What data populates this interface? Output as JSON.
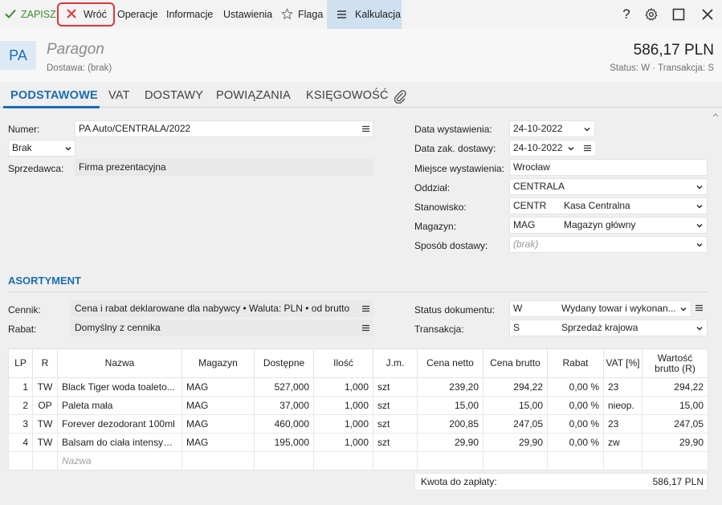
{
  "toolbar": {
    "save_label": "ZAPISZ",
    "back_label": "Wróć",
    "operations_label": "Operacje",
    "info_label": "Informacje",
    "settings_label": "Ustawienia",
    "flag_label": "Flaga",
    "calc_label": "Kalkulacja",
    "right_icons": [
      "help-icon",
      "gear-icon",
      "maximize-icon",
      "close-icon"
    ],
    "help_glyph": "?"
  },
  "header": {
    "badge": "PA",
    "title": "Paragon",
    "subtitle": "Dostawa: (brak)",
    "amount": "586,17 PLN",
    "status_line": "Status: W  ·  Transakcja: S"
  },
  "tabs": [
    "PODSTAWOWE",
    "VAT",
    "DOSTAWY",
    "POWIĄZANIA",
    "KSIĘGOWOŚĆ"
  ],
  "form": {
    "numer_label": "Numer:",
    "numer_value": "PA Auto/CENTRALA/2022",
    "brak_value": "Brak",
    "sprzedawca_label": "Sprzedawca:",
    "sprzedawca_value": "Firma prezentacyjna",
    "data_wyst_label": "Data wystawienia:",
    "data_wyst_value": "24-10-2022",
    "data_zak_label": "Data zak. dostawy:",
    "data_zak_value": "24-10-2022",
    "miejsce_label": "Miejsce wystawienia:",
    "miejsce_value": "Wrocław",
    "oddzial_label": "Oddział:",
    "oddzial_value": "CENTRALA",
    "stanowisko_label": "Stanowisko:",
    "stanowisko_code": "CENTR",
    "stanowisko_name": "Kasa Centralna",
    "magazyn_label": "Magazyn:",
    "magazyn_code": "MAG",
    "magazyn_name": "Magazyn główny",
    "sposob_label": "Sposób dostawy:",
    "sposob_placeholder": "(brak)"
  },
  "assortment": {
    "title": "ASORTYMENT",
    "cennik_label": "Cennik:",
    "cennik_value": "Cena i rabat deklarowane dla nabywcy • Waluta: PLN • od brutto",
    "rabat_label": "Rabat:",
    "rabat_value": "Domyślny z cennika",
    "status_label": "Status dokumentu:",
    "status_code": "W",
    "status_name": "Wydany towar i wykonan...",
    "transakcja_label": "Transakcja:",
    "transakcja_code": "S",
    "transakcja_name": "Sprzedaż krajowa"
  },
  "table": {
    "columns": [
      "LP",
      "R",
      "Nazwa",
      "Magazyn",
      "Dostępne",
      "Ilość",
      "J.m.",
      "Cena netto",
      "Cena brutto",
      "Rabat",
      "VAT [%]",
      "Wartość brutto (R)"
    ],
    "rows": [
      [
        "1",
        "TW",
        "Black Tiger woda toaleto...",
        "MAG",
        "527,000",
        "1,000",
        "szt",
        "239,20",
        "294,22",
        "0,00 %",
        "23",
        "294,22"
      ],
      [
        "2",
        "OP",
        "Paleta mała",
        "MAG",
        "37,000",
        "1,000",
        "szt",
        "15,00",
        "15,00",
        "0,00 %",
        "nieop.",
        "15,00"
      ],
      [
        "3",
        "TW",
        "Forever dezodorant 100ml",
        "MAG",
        "460,000",
        "1,000",
        "szt",
        "200,85",
        "247,05",
        "0,00 %",
        "23",
        "247,05"
      ],
      [
        "4",
        "TW",
        "Balsam do ciała intensyw...",
        "MAG",
        "195,000",
        "1,000",
        "szt",
        "29,90",
        "29,90",
        "0,00 %",
        "zw",
        "29,90"
      ]
    ],
    "new_row_placeholder": "Nazwa"
  },
  "total": {
    "label": "Kwota do zapłaty:",
    "value": "586,17 PLN"
  },
  "colors": {
    "accent": "#1b6db2",
    "save_green": "#3a8a2c",
    "close_red": "#e0353b",
    "highlight_tab": "#cfe0f1"
  }
}
